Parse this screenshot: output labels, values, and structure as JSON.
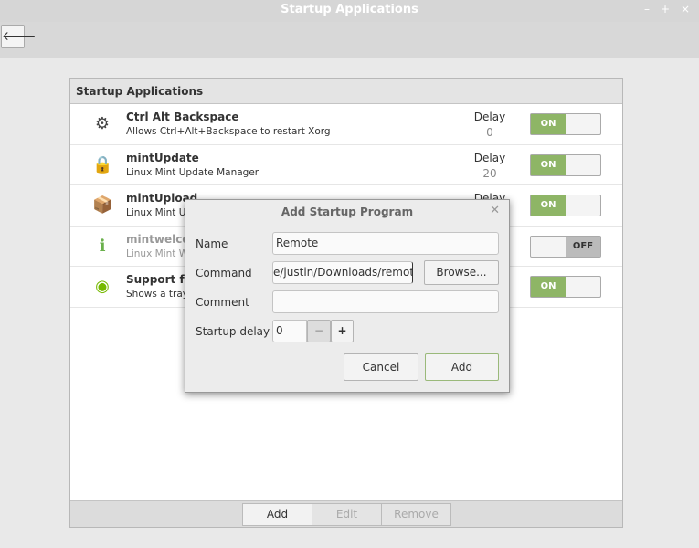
{
  "window": {
    "title": "Startup Applications",
    "controls": [
      "–",
      "+",
      "×"
    ]
  },
  "panel": {
    "header": "Startup Applications",
    "rows": [
      {
        "icon": "gear-icon",
        "glyph": "⚙",
        "name": "Ctrl Alt Backspace",
        "desc": "Allows Ctrl+Alt+Backspace to restart Xorg",
        "delay_label": "Delay",
        "delay": "0",
        "state": "ON",
        "enabled": true
      },
      {
        "icon": "lock-icon",
        "glyph": "🔒",
        "name": "mintUpdate",
        "desc": "Linux Mint Update Manager",
        "delay_label": "Delay",
        "delay": "20",
        "state": "ON",
        "enabled": true
      },
      {
        "icon": "package-upload-icon",
        "glyph": "📦",
        "name": "mintUpload",
        "desc": "Linux Mint Up",
        "delay_label": "Delay",
        "state": "ON",
        "enabled": true
      },
      {
        "icon": "info-chat-icon",
        "glyph": "ℹ",
        "name": "mintwelco",
        "desc": "Linux Mint W",
        "state": "OFF",
        "enabled": false
      },
      {
        "icon": "nvidia-icon",
        "glyph": "◉",
        "name": "Support fo",
        "desc": "Shows a tray",
        "state": "ON",
        "enabled": true
      }
    ],
    "buttons": {
      "add": "Add",
      "edit": "Edit",
      "remove": "Remove"
    }
  },
  "dialog": {
    "title": "Add Startup Program",
    "name_label": "Name",
    "name_value": "Remote",
    "command_label": "Command",
    "command_value": "e/justin/Downloads/remote",
    "browse": "Browse...",
    "comment_label": "Comment",
    "comment_value": "",
    "delay_label": "Startup delay",
    "delay_value": "0",
    "minus": "−",
    "plus": "+",
    "cancel": "Cancel",
    "add": "Add"
  }
}
